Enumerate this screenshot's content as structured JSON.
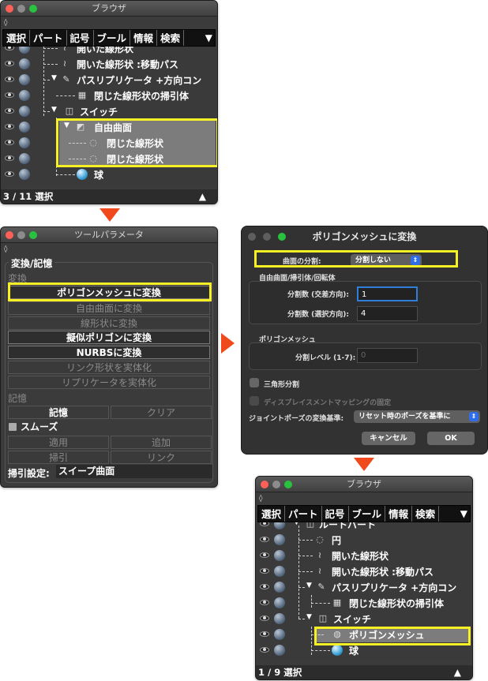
{
  "browser1": {
    "title": "ブラウザ",
    "tabs": [
      "選択",
      "パート",
      "記号",
      "ブール",
      "情報",
      "検索"
    ],
    "rows": [
      "開いた線形状",
      "開いた線形状 :移動パス",
      "パスリプリケータ +方向コン",
      "閉じた線形状の掃引体",
      "スイッチ",
      "自由曲面",
      "閉じた線形状",
      "閉じた線形状",
      "球"
    ],
    "status": "3 / 11 選択"
  },
  "toolparam": {
    "title": "ツールパラメータ",
    "group_convert": "変換/記憶",
    "label_convert": "変換",
    "btn_polymesh": "ポリゴンメッシュに変換",
    "btn_freeform": "自由曲面に変換",
    "btn_linear": "線形状に変換",
    "btn_pseudo": "擬似ポリゴンに変換",
    "btn_nurbs": "NURBSに変換",
    "btn_link": "リンク形状を実体化",
    "btn_replicator": "リプリケータを実体化",
    "label_memory": "記憶",
    "btn_memory": "記憶",
    "btn_clear": "クリア",
    "label_smooth": "スムーズ",
    "btn_apply": "適用",
    "btn_add": "追加",
    "btn_subtract": "掃引",
    "btn_link2": "リンク",
    "sweep_label": "掃引設定:",
    "sweep_value": "スイープ曲面"
  },
  "dialog": {
    "title": "ポリゴンメッシュに変換",
    "surface_div_label": "曲面の分割:",
    "surface_div_value": "分割しない",
    "section_freeform": "自由曲面/掃引体/回転体",
    "div_cross_label": "分割数 (交差方向):",
    "div_cross_value": "1",
    "div_sel_label": "分割数 (選択方向):",
    "div_sel_value": "4",
    "section_polymesh": "ポリゴンメッシュ",
    "div_level_label": "分割レベル (1-7):",
    "div_level_value": "0",
    "triangle_label": "三角形分割",
    "displacement_label": "ディスプレイスメントマッピングの固定",
    "joint_label": "ジョイントポーズの変換基準:",
    "joint_value": "リセット時のポーズを基準に",
    "cancel": "キャンセル",
    "ok": "OK"
  },
  "browser2": {
    "title": "ブラウザ",
    "tabs": [
      "選択",
      "パート",
      "記号",
      "ブール",
      "情報",
      "検索"
    ],
    "rows": [
      "ルートパート",
      "円",
      "開いた線形状",
      "開いた線形状 :移動パス",
      "パスリプリケータ +方向コン",
      "閉じた線形状の掃引体",
      "スイッチ",
      "ポリゴンメッシュ",
      "球"
    ],
    "status": "1 / 9 選択"
  },
  "colors": {
    "highlight": "#f7f024",
    "arrow": "#f04a1c",
    "selection": "#7c7c7c"
  }
}
